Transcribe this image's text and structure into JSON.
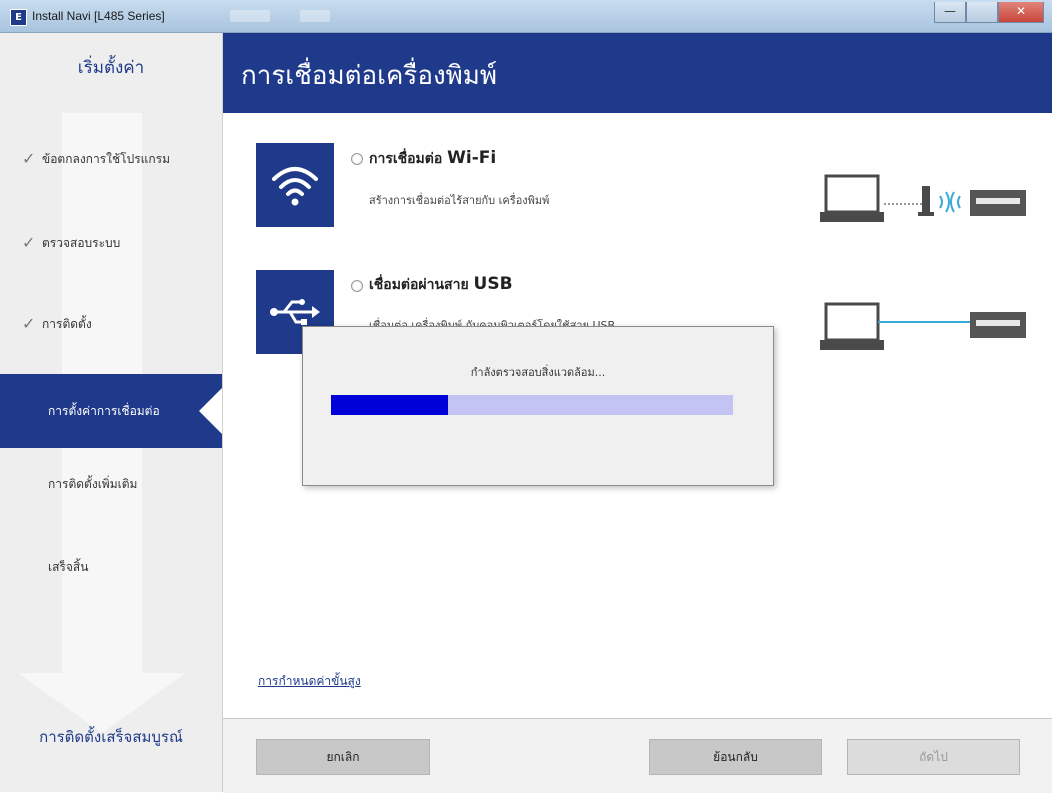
{
  "window": {
    "title": "Install Navi [L485 Series]",
    "icon_letter": "E",
    "minimize_glyph": "—",
    "close_glyph": "✕"
  },
  "sidebar": {
    "heading": "เริ่มตั้งค่า",
    "items": [
      {
        "label": "ข้อตกลงการใช้โปรแกรม",
        "checked": true
      },
      {
        "label": "ตรวจสอบระบบ",
        "checked": true
      },
      {
        "label": "การติดตั้ง",
        "checked": true
      },
      {
        "label": "การตั้งค่าการเชื่อมต่อ",
        "active": true
      },
      {
        "label": "การติดตั้งเพิ่มเติม"
      },
      {
        "label": "เสร็จสิ้น"
      }
    ],
    "check_glyph": "✓",
    "footer": "การติดตั้งเสร็จสมบูรณ์"
  },
  "header": {
    "title": "การเชื่อมต่อเครื่องพิมพ์"
  },
  "options": {
    "wifi": {
      "title_prefix": "การเชื่อมต่อ",
      "title_suffix": "Wi-Fi",
      "description": "สร้างการเชื่อมต่อไร้สายกับ เครื่องพิมพ์",
      "icon": "wifi-icon"
    },
    "usb": {
      "title_prefix": "เชื่อมต่อผ่านสาย",
      "title_suffix": "USB",
      "description": "เชื่อมต่อ เครื่องพิมพ์ กับคอมพิวเตอร์โดยใช้สาย USB",
      "icon": "usb-icon"
    }
  },
  "dialog": {
    "message": "กำลังตรวจสอบสิ่งแวดล้อม...",
    "progress": 0.29
  },
  "advanced_link": "การกำหนดค่าขั้นสูง",
  "footer": {
    "cancel": "ยกเลิก",
    "back": "ย้อนกลับ",
    "next": "ถัดไป"
  },
  "colors": {
    "brand": "#1f3a8a",
    "progress_fill": "#0000d8",
    "progress_track": "#c4c4f4"
  }
}
